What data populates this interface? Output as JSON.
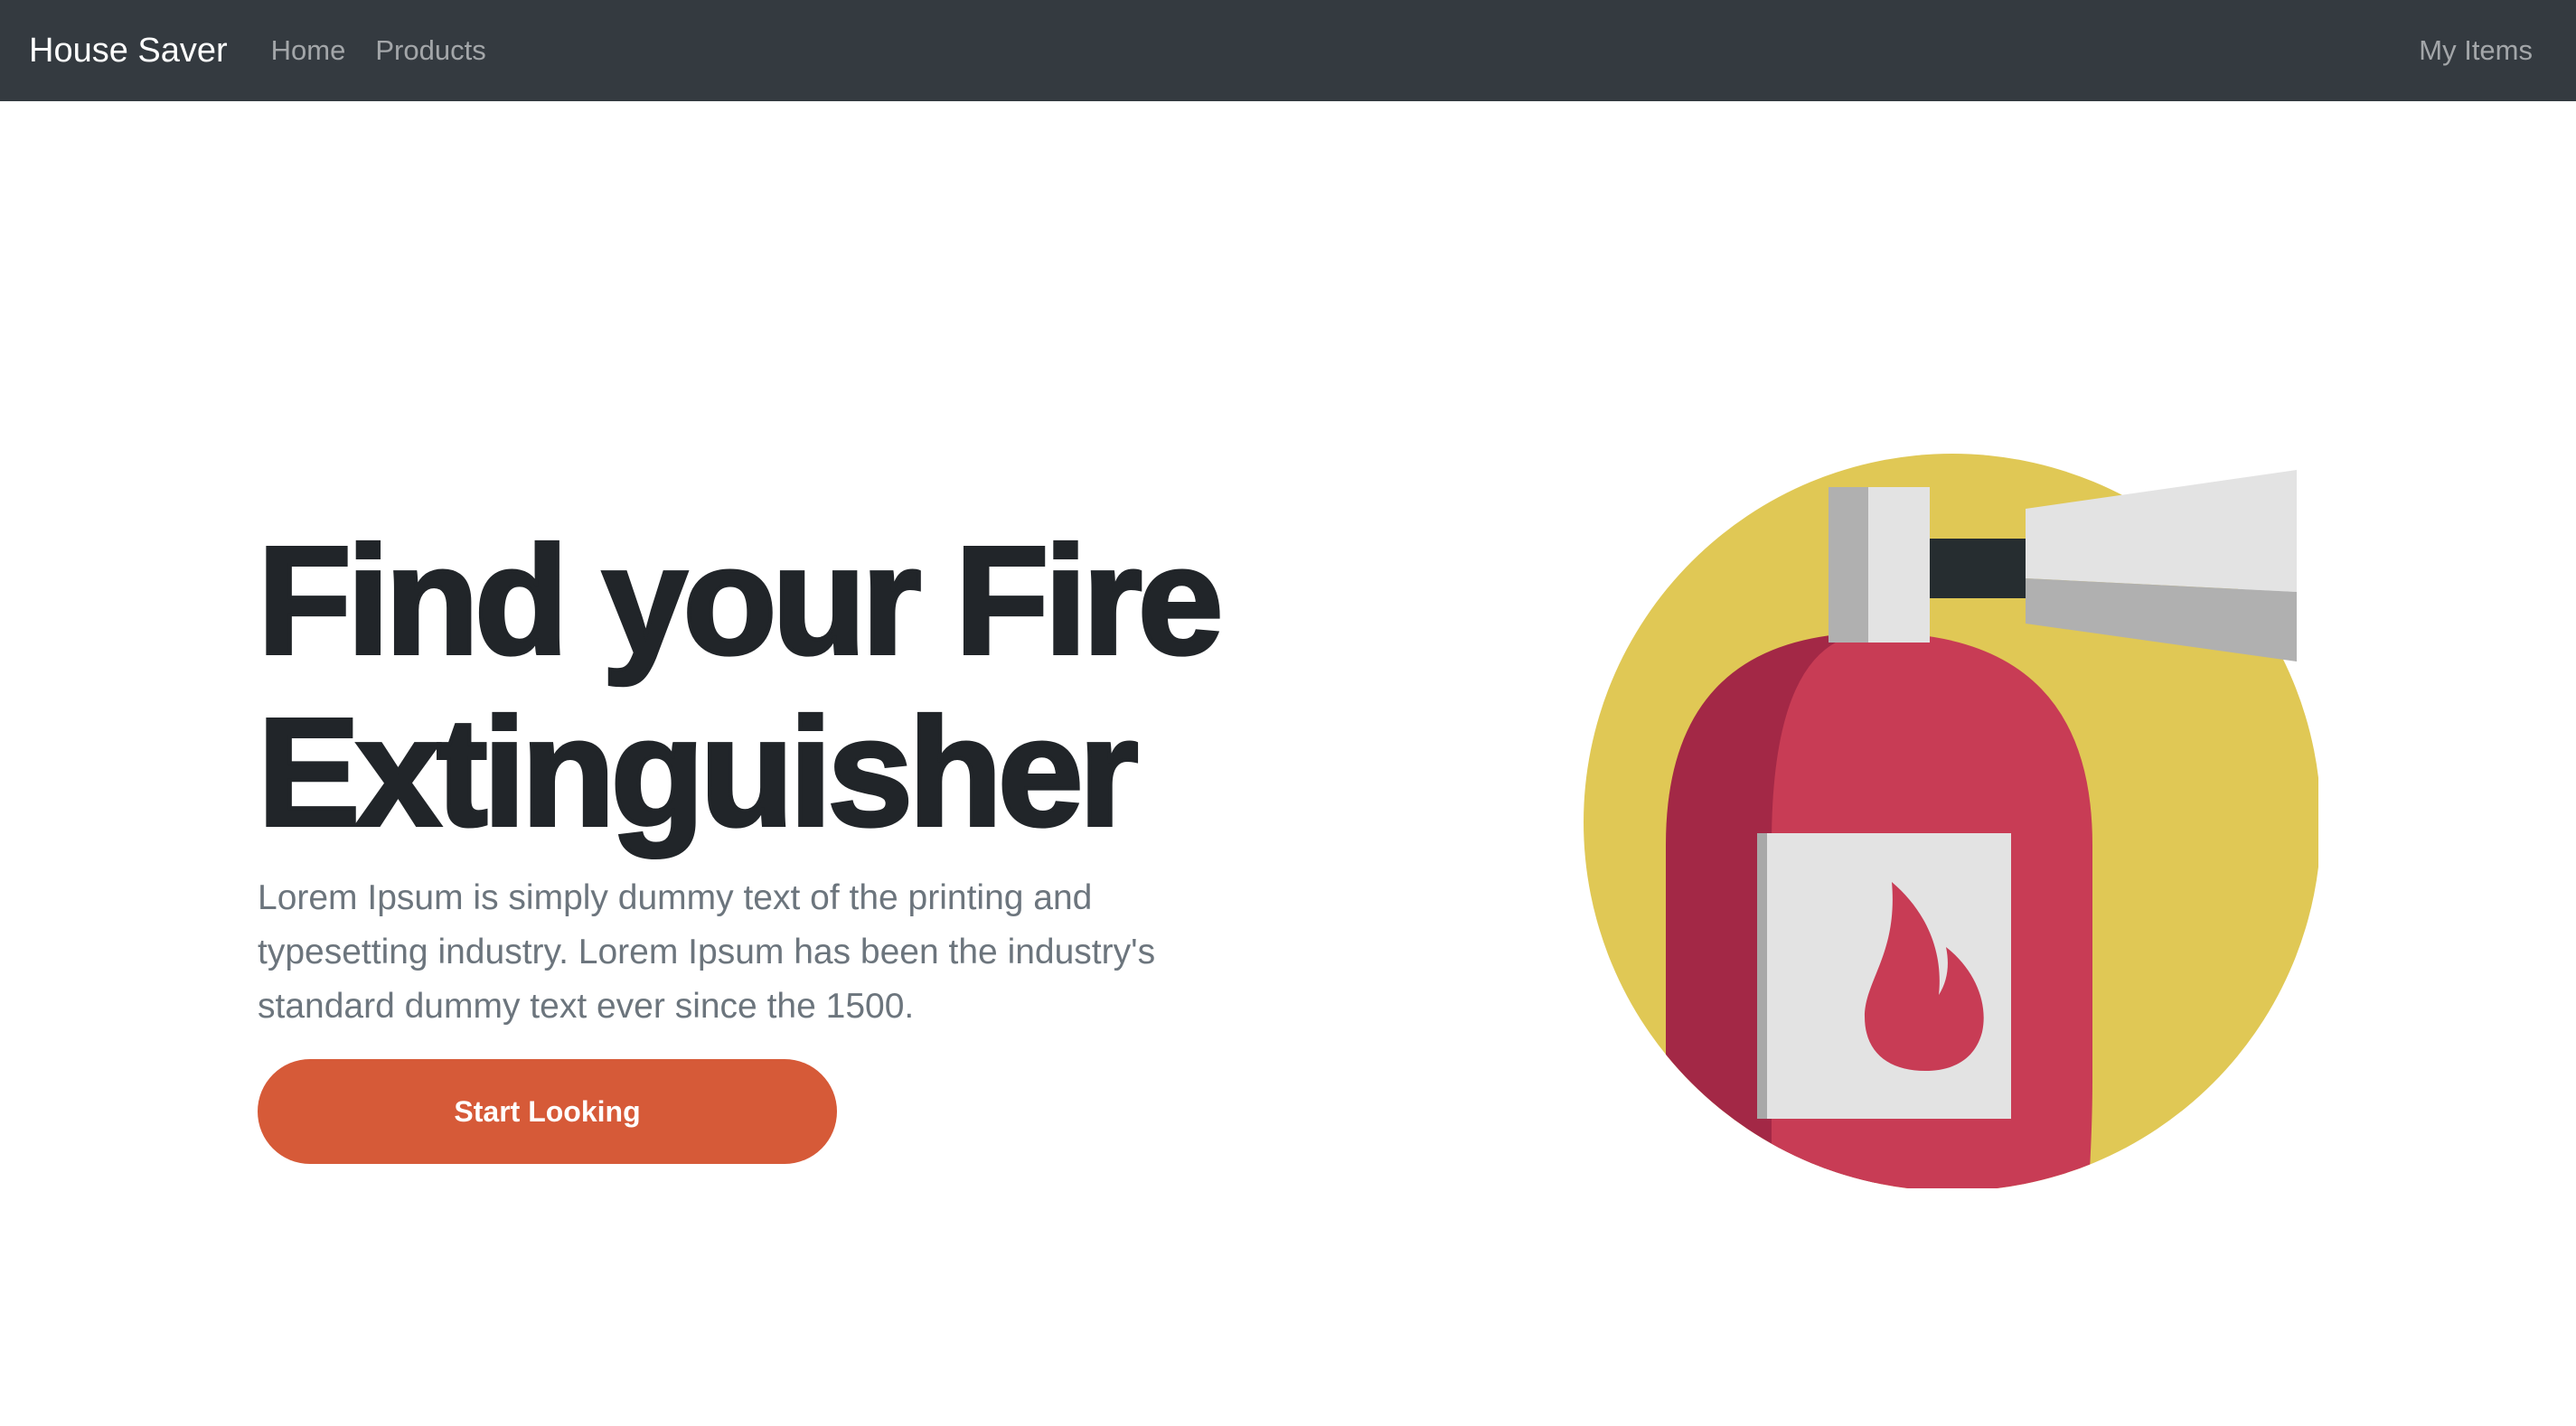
{
  "navbar": {
    "brand": "House Saver",
    "links": [
      "Home",
      "Products"
    ],
    "right_link": "My Items",
    "background": "#343a40"
  },
  "hero": {
    "title_line1": "Find your Fire",
    "title_line2": "Extinguisher",
    "description": "Lorem Ipsum is simply dummy text of the printing and typesetting industry. Lorem Ipsum has been the industry's standard dummy text ever since the 1500.",
    "cta_label": "Start Looking",
    "cta_color": "#d65a38"
  },
  "illustration": {
    "icon": "fire-extinguisher-icon",
    "colors": {
      "circle": "#e0c855",
      "body": "#c83c55",
      "body_shadow": "#a32846",
      "label": "#e3e3e3",
      "nozzle_light": "#e3e3e3",
      "nozzle_dark": "#b0b0b0",
      "hose": "#262d30"
    }
  }
}
